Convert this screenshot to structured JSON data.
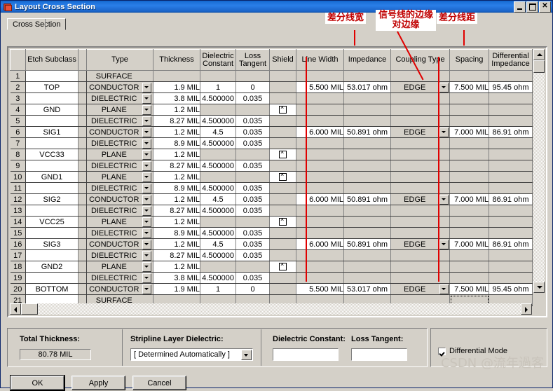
{
  "window": {
    "title": "Layout Cross Section",
    "icon": "layers-icon",
    "sys_buttons": {
      "minimize": "minimize-icon",
      "maximize": "maximize-icon",
      "close": "close-icon"
    }
  },
  "tabs": [
    {
      "label": "Cross Section"
    }
  ],
  "grid": {
    "columns": [
      {
        "key": "rownum",
        "label": ""
      },
      {
        "key": "subclass",
        "label": "Etch Subclass"
      },
      {
        "key": "color",
        "label": ""
      },
      {
        "key": "type",
        "label": "Type"
      },
      {
        "key": "thickness",
        "label": "Thickness"
      },
      {
        "key": "dk",
        "label": "Dielectric Constant"
      },
      {
        "key": "lt",
        "label": "Loss Tangent"
      },
      {
        "key": "shield",
        "label": "Shield"
      },
      {
        "key": "linewidth",
        "label": "Line Width"
      },
      {
        "key": "impedance",
        "label": "Impedance"
      },
      {
        "key": "coupling",
        "label": "Coupling Type"
      },
      {
        "key": "spacing",
        "label": "Spacing"
      },
      {
        "key": "diffimp",
        "label": "Differential Impedance"
      }
    ],
    "rows": [
      {
        "n": "1",
        "subclass": "",
        "color": "#ffffff",
        "type": "SURFACE",
        "dd": false,
        "thickness": "",
        "dk": "",
        "lt": "",
        "shield": false,
        "linewidth": "",
        "impedance": "",
        "coupling": "",
        "cdd": false,
        "spacing": "",
        "diffimp": ""
      },
      {
        "n": "2",
        "subclass": "TOP",
        "color": "#ffff00",
        "type": "CONDUCTOR",
        "dd": true,
        "thickness": "1.9 MIL",
        "dk": "1",
        "lt": "0",
        "shield": false,
        "linewidth": "5.500 MIL",
        "impedance": "53.017 ohm",
        "coupling": "EDGE",
        "cdd": true,
        "spacing": "7.500 MIL",
        "diffimp": "95.45 ohm"
      },
      {
        "n": "3",
        "subclass": "",
        "color": "#00ee00",
        "type": "DIELECTRIC",
        "dd": true,
        "thickness": "3.8 MIL",
        "dk": "4.500000",
        "lt": "0.035",
        "shield": false,
        "linewidth": "",
        "impedance": "",
        "coupling": "",
        "cdd": false,
        "spacing": "",
        "diffimp": ""
      },
      {
        "n": "4",
        "subclass": "GND",
        "color": "#ff0000",
        "type": "PLANE",
        "dd": true,
        "thickness": "1.2 MIL",
        "dk": "",
        "lt": "",
        "shield": true,
        "linewidth": "",
        "impedance": "",
        "coupling": "",
        "cdd": false,
        "spacing": "",
        "diffimp": ""
      },
      {
        "n": "5",
        "subclass": "",
        "color": "#00ee00",
        "type": "DIELECTRIC",
        "dd": true,
        "thickness": "8.27 MIL",
        "dk": "4.500000",
        "lt": "0.035",
        "shield": false,
        "linewidth": "",
        "impedance": "",
        "coupling": "",
        "cdd": false,
        "spacing": "",
        "diffimp": ""
      },
      {
        "n": "6",
        "subclass": "SIG1",
        "color": "#ffff00",
        "type": "CONDUCTOR",
        "dd": true,
        "thickness": "1.2 MIL",
        "dk": "4.5",
        "lt": "0.035",
        "shield": false,
        "linewidth": "6.000 MIL",
        "impedance": "50.891 ohm",
        "coupling": "EDGE",
        "cdd": true,
        "spacing": "7.000 MIL",
        "diffimp": "86.91 ohm"
      },
      {
        "n": "7",
        "subclass": "",
        "color": "#00ee00",
        "type": "DIELECTRIC",
        "dd": true,
        "thickness": "8.9 MIL",
        "dk": "4.500000",
        "lt": "0.035",
        "shield": false,
        "linewidth": "",
        "impedance": "",
        "coupling": "",
        "cdd": false,
        "spacing": "",
        "diffimp": ""
      },
      {
        "n": "8",
        "subclass": "VCC33",
        "color": "#ff0000",
        "type": "PLANE",
        "dd": true,
        "thickness": "1.2 MIL",
        "dk": "",
        "lt": "",
        "shield": true,
        "linewidth": "",
        "impedance": "",
        "coupling": "",
        "cdd": false,
        "spacing": "",
        "diffimp": ""
      },
      {
        "n": "9",
        "subclass": "",
        "color": "#00ee00",
        "type": "DIELECTRIC",
        "dd": true,
        "thickness": "8.27 MIL",
        "dk": "4.500000",
        "lt": "0.035",
        "shield": false,
        "linewidth": "",
        "impedance": "",
        "coupling": "",
        "cdd": false,
        "spacing": "",
        "diffimp": ""
      },
      {
        "n": "10",
        "subclass": "GND1",
        "color": "#ff0000",
        "type": "PLANE",
        "dd": true,
        "thickness": "1.2 MIL",
        "dk": "",
        "lt": "",
        "shield": true,
        "linewidth": "",
        "impedance": "",
        "coupling": "",
        "cdd": false,
        "spacing": "",
        "diffimp": ""
      },
      {
        "n": "11",
        "subclass": "",
        "color": "#00ee00",
        "type": "DIELECTRIC",
        "dd": true,
        "thickness": "8.9 MIL",
        "dk": "4.500000",
        "lt": "0.035",
        "shield": false,
        "linewidth": "",
        "impedance": "",
        "coupling": "",
        "cdd": false,
        "spacing": "",
        "diffimp": ""
      },
      {
        "n": "12",
        "subclass": "SIG2",
        "color": "#ffff00",
        "type": "CONDUCTOR",
        "dd": true,
        "thickness": "1.2 MIL",
        "dk": "4.5",
        "lt": "0.035",
        "shield": false,
        "linewidth": "6.000 MIL",
        "impedance": "50.891 ohm",
        "coupling": "EDGE",
        "cdd": true,
        "spacing": "7.000 MIL",
        "diffimp": "86.91 ohm"
      },
      {
        "n": "13",
        "subclass": "",
        "color": "#00ee00",
        "type": "DIELECTRIC",
        "dd": true,
        "thickness": "8.27 MIL",
        "dk": "4.500000",
        "lt": "0.035",
        "shield": false,
        "linewidth": "",
        "impedance": "",
        "coupling": "",
        "cdd": false,
        "spacing": "",
        "diffimp": ""
      },
      {
        "n": "14",
        "subclass": "VCC25",
        "color": "#ff0000",
        "type": "PLANE",
        "dd": true,
        "thickness": "1.2 MIL",
        "dk": "",
        "lt": "",
        "shield": true,
        "linewidth": "",
        "impedance": "",
        "coupling": "",
        "cdd": false,
        "spacing": "",
        "diffimp": ""
      },
      {
        "n": "15",
        "subclass": "",
        "color": "#00ee00",
        "type": "DIELECTRIC",
        "dd": true,
        "thickness": "8.9 MIL",
        "dk": "4.500000",
        "lt": "0.035",
        "shield": false,
        "linewidth": "",
        "impedance": "",
        "coupling": "",
        "cdd": false,
        "spacing": "",
        "diffimp": ""
      },
      {
        "n": "16",
        "subclass": "SIG3",
        "color": "#ffff00",
        "type": "CONDUCTOR",
        "dd": true,
        "thickness": "1.2 MIL",
        "dk": "4.5",
        "lt": "0.035",
        "shield": false,
        "linewidth": "6.000 MIL",
        "impedance": "50.891 ohm",
        "coupling": "EDGE",
        "cdd": true,
        "spacing": "7.000 MIL",
        "diffimp": "86.91 ohm"
      },
      {
        "n": "17",
        "subclass": "",
        "color": "#00ee00",
        "type": "DIELECTRIC",
        "dd": true,
        "thickness": "8.27 MIL",
        "dk": "4.500000",
        "lt": "0.035",
        "shield": false,
        "linewidth": "",
        "impedance": "",
        "coupling": "",
        "cdd": false,
        "spacing": "",
        "diffimp": ""
      },
      {
        "n": "18",
        "subclass": "GND2",
        "color": "#ff0000",
        "type": "PLANE",
        "dd": true,
        "thickness": "1.2 MIL",
        "dk": "",
        "lt": "",
        "shield": true,
        "linewidth": "",
        "impedance": "",
        "coupling": "",
        "cdd": false,
        "spacing": "",
        "diffimp": ""
      },
      {
        "n": "19",
        "subclass": "",
        "color": "#00ee00",
        "type": "DIELECTRIC",
        "dd": true,
        "thickness": "3.8 MIL",
        "dk": "4.500000",
        "lt": "0.035",
        "shield": false,
        "linewidth": "",
        "impedance": "",
        "coupling": "",
        "cdd": false,
        "spacing": "",
        "diffimp": ""
      },
      {
        "n": "20",
        "subclass": "BOTTOM",
        "color": "#ffff00",
        "type": "CONDUCTOR",
        "dd": true,
        "thickness": "1.9 MIL",
        "dk": "1",
        "lt": "0",
        "shield": false,
        "linewidth": "5.500 MIL",
        "impedance": "53.017 ohm",
        "coupling": "EDGE",
        "cdd": true,
        "spacing": "7.500 MIL",
        "diffimp": "95.45 ohm"
      },
      {
        "n": "21",
        "subclass": "",
        "color": "#ffffff",
        "type": "SURFACE",
        "dd": false,
        "thickness": "",
        "dk": "",
        "lt": "",
        "shield": false,
        "linewidth": "",
        "impedance": "",
        "coupling": "",
        "cdd": false,
        "spacing": "",
        "diffimp": "",
        "selected_cell": "spacing"
      }
    ]
  },
  "bottom": {
    "total_thickness": {
      "label": "Total Thickness:",
      "value": "80.78 MIL"
    },
    "stripline": {
      "label": "Stripline Layer Dielectric:",
      "value": "[  Determined Automatically  ]"
    },
    "dielectric_constant": {
      "label": "Dielectric Constant:",
      "value": ""
    },
    "loss_tangent": {
      "label": "Loss Tangent:",
      "value": ""
    },
    "differential_mode": {
      "label": "Differential Mode",
      "checked": true
    }
  },
  "buttons": {
    "ok": "OK",
    "apply": "Apply",
    "cancel": "Cancel"
  },
  "annotations": [
    {
      "id": "diff-line-width",
      "text": "差分线宽"
    },
    {
      "id": "signal-edge-to-edge",
      "text": "信号线的边缘对边缘"
    },
    {
      "id": "diff-line-spacing",
      "text": "差分线距"
    }
  ],
  "watermark": "CSDN @流年過客",
  "colors": {
    "annotation": "#c00000",
    "line": "#e00000",
    "face": "#d4d0c8",
    "titlebar": "#1b6fd6"
  }
}
